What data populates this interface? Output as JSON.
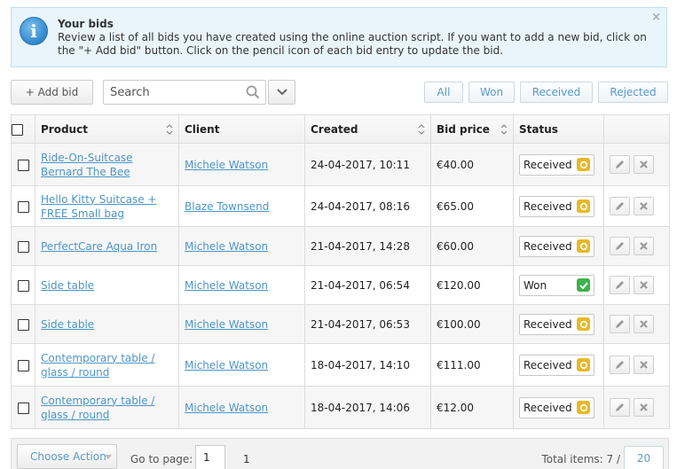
{
  "notice": {
    "title": "Your bids",
    "text": "Review a list of all bids you have created using the online auction script. If you want to add a new bid, click on the \"+ Add bid\" button. Click on the pencil icon of each bid entry to update the bid.",
    "close": "×",
    "icon_glyph": "i"
  },
  "toolbar": {
    "add_label": "+ Add bid",
    "search_placeholder": "Search",
    "filters": [
      "All",
      "Won",
      "Received",
      "Rejected"
    ]
  },
  "table": {
    "columns": [
      "Product",
      "Client",
      "Created",
      "Bid price",
      "Status"
    ],
    "rows": [
      {
        "product": "Ride-On-Suitcase Bernard The Bee",
        "client": "Michele Watson",
        "created": "24-04-2017, 10:11",
        "price": "€40.00",
        "status": "Received"
      },
      {
        "product": "Hello Kitty Suitcase + FREE Small bag",
        "client": "Blaze Townsend",
        "created": "24-04-2017, 08:16",
        "price": "€65.00",
        "status": "Received"
      },
      {
        "product": "PerfectCare Aqua Iron",
        "client": "Michele Watson",
        "created": "21-04-2017, 14:28",
        "price": "€60.00",
        "status": "Received"
      },
      {
        "product": "Side table",
        "client": "Michele Watson",
        "created": "21-04-2017, 06:54",
        "price": "€120.00",
        "status": "Won"
      },
      {
        "product": "Side table",
        "client": "Michele Watson",
        "created": "21-04-2017, 06:53",
        "price": "€100.00",
        "status": "Received"
      },
      {
        "product": "Contemporary table / glass / round",
        "client": "Michele Watson",
        "created": "18-04-2017, 14:10",
        "price": "€111.00",
        "status": "Received"
      },
      {
        "product": "Contemporary table / glass / round",
        "client": "Michele Watson",
        "created": "18-04-2017, 14:06",
        "price": "€12.00",
        "status": "Received"
      }
    ]
  },
  "footer": {
    "choose_action": "Choose Action",
    "goto_label": "Go to page:",
    "goto_value": "1",
    "page": "1",
    "total_label": "Total items: 7 /",
    "per_page": "20"
  },
  "colors": {
    "link": "#4d95c7",
    "received": "#e7b928",
    "won": "#3db34a",
    "notice_bg": "#e9f5fb"
  }
}
